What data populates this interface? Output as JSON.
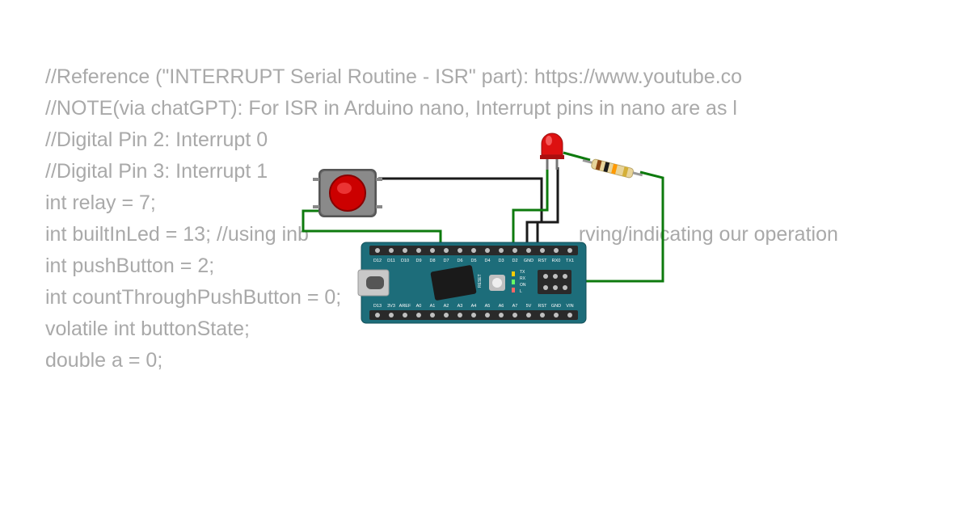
{
  "code": {
    "line1": "//Reference (\"INTERRUPT Serial Routine - ISR\" part): https://www.youtube.co",
    "line2": "//NOTE(via chatGPT): For ISR in Arduino nano, Interrupt pins in nano are as l",
    "line3": "//Digital Pin 2: Interrupt 0",
    "line4": "//Digital Pin 3: Interrupt 1",
    "line5": "",
    "line6": "int relay = 7;",
    "line7": "int builtInLed = 13; //using inb",
    "line7b": "rving/indicating our operation",
    "line8": "int pushButton = 2;",
    "line9": "int countThroughPushButton = 0;",
    "line10": "",
    "line11": "volatile int buttonState;",
    "line12": "double a = 0;"
  },
  "circuit": {
    "board_label": "Arduino Nano",
    "top_pins": [
      "D13",
      "3V3",
      "AREF",
      "A0",
      "A1",
      "A2",
      "A3",
      "A4",
      "A5",
      "A6",
      "A7",
      "5V",
      "RST",
      "GND",
      "VIN"
    ],
    "bottom_pins": [
      "D12",
      "D11",
      "D10",
      "D9",
      "D8",
      "D7",
      "D6",
      "D5",
      "D4",
      "D3",
      "D2",
      "GND",
      "RST",
      "RX0",
      "TX1"
    ],
    "components": {
      "push_button": "Push Button",
      "led": "Red LED",
      "resistor": "Resistor",
      "usb": "USB Mini"
    },
    "wires": {
      "green1": "Button to D7",
      "black1": "Button to GND",
      "green2": "LED anode to D2",
      "black2": "LED cathode to GND",
      "green3": "Resistor to VIN"
    }
  }
}
